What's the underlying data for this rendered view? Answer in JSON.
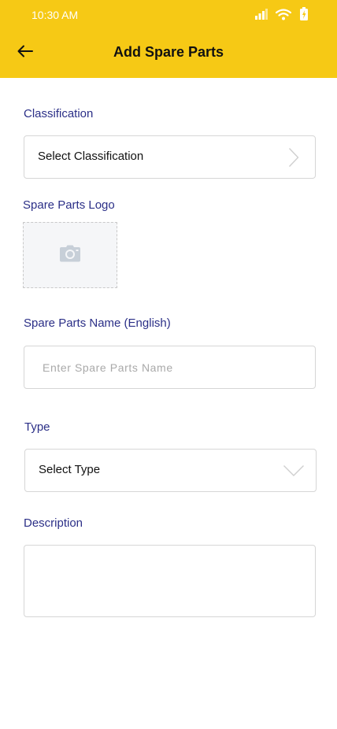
{
  "status_bar": {
    "time": "10:30 AM",
    "icons": [
      "signal-icon",
      "wifi-icon",
      "battery-charging-icon"
    ]
  },
  "header": {
    "title": "Add Spare Parts",
    "back_icon": "arrow-left-icon",
    "background": "#F6C915"
  },
  "form": {
    "classification": {
      "label": "Classification",
      "value": "Select Classification",
      "icon": "chevron-right-icon"
    },
    "logo": {
      "label": "Spare Parts Logo",
      "icon": "camera-icon"
    },
    "name": {
      "label": "Spare Parts Name (English)",
      "placeholder": "Enter Spare Parts Name"
    },
    "type": {
      "label": "Type",
      "value": "Select Type",
      "icon": "chevron-down-icon"
    },
    "description": {
      "label": "Description",
      "value": ""
    }
  },
  "colors": {
    "label": "#2B2F87",
    "border": "#d6d6d6",
    "placeholder": "#a9a9a9"
  }
}
